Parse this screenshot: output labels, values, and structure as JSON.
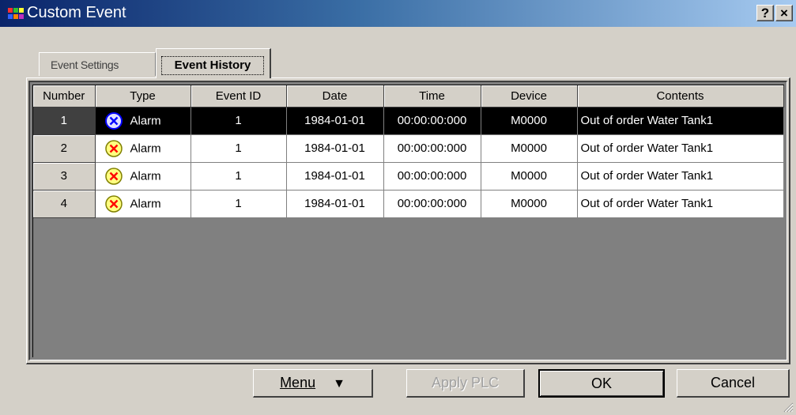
{
  "window": {
    "title": "Custom Event",
    "help_label": "?",
    "close_label": "×"
  },
  "tabs": [
    {
      "label": "Event Settings",
      "active": false
    },
    {
      "label": "Event History",
      "active": true
    }
  ],
  "grid": {
    "columns": [
      "Number",
      "Type",
      "Event ID",
      "Date",
      "Time",
      "Device",
      "Contents"
    ],
    "rows": [
      {
        "number": "1",
        "type": "Alarm",
        "event_id": "1",
        "date": "1984-01-01",
        "time": "00:00:00:000",
        "device": "M0000",
        "contents": "Out of order Water Tank1",
        "selected": true
      },
      {
        "number": "2",
        "type": "Alarm",
        "event_id": "1",
        "date": "1984-01-01",
        "time": "00:00:00:000",
        "device": "M0000",
        "contents": "Out of order Water Tank1",
        "selected": false
      },
      {
        "number": "3",
        "type": "Alarm",
        "event_id": "1",
        "date": "1984-01-01",
        "time": "00:00:00:000",
        "device": "M0000",
        "contents": "Out of order Water Tank1",
        "selected": false
      },
      {
        "number": "4",
        "type": "Alarm",
        "event_id": "1",
        "date": "1984-01-01",
        "time": "00:00:00:000",
        "device": "M0000",
        "contents": "Out of order Water Tank1",
        "selected": false
      }
    ]
  },
  "buttons": {
    "menu_label": "Menu",
    "menu_arrow": "▼",
    "apply_label": "Apply PLC",
    "ok_label": "OK",
    "cancel_label": "Cancel"
  },
  "icons": {
    "alarm_icon": "alarm-x-icon",
    "alarm_selected_color": "#0000ff",
    "alarm_color": "#ff0000"
  }
}
